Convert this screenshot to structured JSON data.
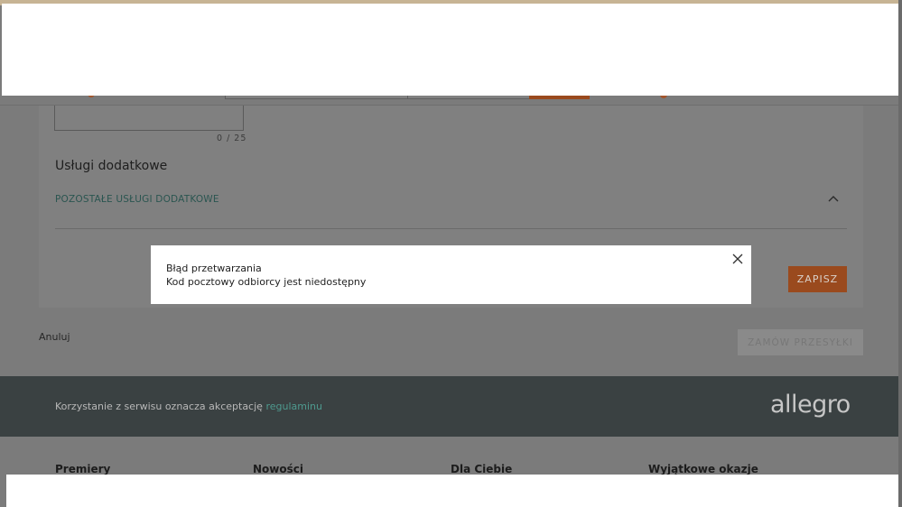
{
  "form": {
    "char_counter": "0 / 25",
    "section_title": "Usługi dodatkowe",
    "other_services_label": "POZOSTAŁE USŁUGI DODATKOWE",
    "save_label": "ZAPISZ"
  },
  "actions": {
    "cancel_label": "Anuluj",
    "order_label": "ZAMÓW PRZESYŁKI"
  },
  "footer": {
    "terms_text": "Korzystanie z serwisu oznacza akceptację ",
    "terms_link": "regulaminu",
    "logo": "allegro",
    "columns": [
      "Premiery",
      "Nowości",
      "Dla Ciebie",
      "Wyjątkowe okazje"
    ]
  },
  "modal": {
    "title": "Błąd przetwarzania",
    "message": "Kod pocztowy odbiorcy jest niedostępny"
  },
  "colors": {
    "accent": "#ff5a00",
    "teal": "#00a790",
    "footer_dark": "#3a4142"
  },
  "icons": {
    "close": "close-icon",
    "chevron": "chevron-up-icon"
  }
}
